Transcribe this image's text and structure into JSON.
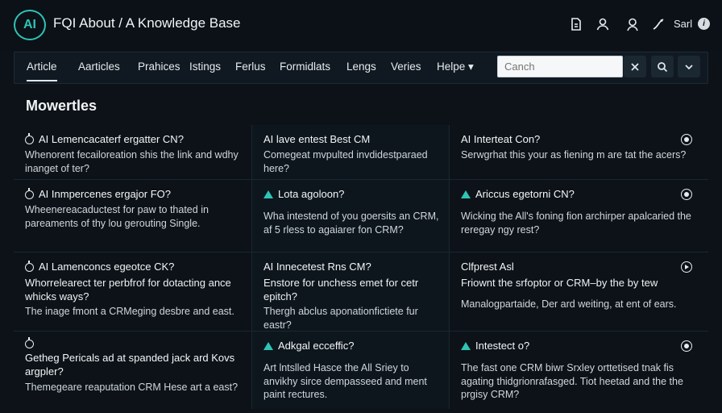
{
  "header": {
    "logo": "AI",
    "title": "FQI About / A Knowledge Base",
    "icons": [
      "document-icon",
      "user-icon",
      "account-icon",
      "edit-icon"
    ],
    "signin": "Sarl",
    "info_icon": "i"
  },
  "nav": {
    "tabs": [
      {
        "label": "Article",
        "active": true
      },
      {
        "label": "Aarticles"
      },
      {
        "label": "Prahices"
      },
      {
        "label": "Istings"
      },
      {
        "label": "Ferlus"
      },
      {
        "label": "Formidlats"
      },
      {
        "label": "Lengs"
      },
      {
        "label": "Veries"
      },
      {
        "label": "Helpe ▾"
      }
    ],
    "search": {
      "value": "",
      "placeholder": "Canch"
    }
  },
  "section_title": "Mowertles",
  "cards": [
    {
      "title": "AI Lemencacaterf ergatter CN?",
      "body": "Whenorent fecailoreation shis the link and wdhy inanget of ter?",
      "icon": "circle-icon"
    },
    {
      "title": "AI lave entest Best CM",
      "body": "Comegeat mvpulted invdidestparaed here?",
      "icon": ""
    },
    {
      "title": "AI Interteat Con?",
      "body": "Serwgrhat this your as fiening m are tat the acers?",
      "icon": "",
      "badge": "radio-icon"
    },
    {
      "title": "AI Inmpercenes ergajor FO?",
      "body": "Wheenereacaductest for paw to thated in pareaments of thy lou gerouting Single.",
      "icon": "circle-icon"
    },
    {
      "title": "Lota agoloon?",
      "body": "Wha intestend of you goersits an CRM, af 5 rless to agaiarer fon CRM?",
      "icon": "triangle-icon"
    },
    {
      "title": "Ariccus egetorni CN?",
      "body": "Wicking the All's foning fion archirper apalcaried the reregay ngy rest?",
      "icon": "triangle-icon",
      "badge": "radio-icon"
    },
    {
      "title": "AI Lamenconcs egeotce CK?",
      "body": "Whorrelearect ter perbfrof for dotacting ance whicks ways?",
      "body2": "The inage fmont a CRMeging desbre and east.",
      "icon": "circle-icon"
    },
    {
      "title": "AI Innecetest Rns CM?",
      "body": "Enstore for unchess emet for cetr epitch?",
      "body2": "Thergh abclus aponationfictiete fur eastr?",
      "icon": ""
    },
    {
      "title": "Clfprest Asl",
      "body": "Friownt the srfoptor or CRM–by the by tew",
      "body2": "Manalogpartaide, Der ard weiting, at ent of ears.",
      "icon": "",
      "badge": "play-icon"
    },
    {
      "title": "Getheg Pericals ad at spanded jack ard Kovs argpler?",
      "body": "Themegeare reaputation CRM Hese art a east?",
      "icon": "circle-icon"
    },
    {
      "title": "Adkgal ecceffic?",
      "body": "Art lntslled Hasce the All Sriey to anvikhy sirce dempasseed and ment paint rectures.",
      "icon": "triangle-icon"
    },
    {
      "title": "Intestect o?",
      "body": "The fast one CRM biwr Srxley orttetised tnak fis agating thidgrionrafasged. Tiot heetad and the the prgisy CRM?",
      "icon": "triangle-icon",
      "badge": "radio-icon"
    }
  ]
}
